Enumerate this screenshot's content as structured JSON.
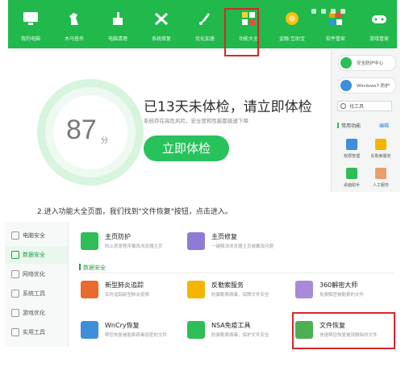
{
  "toolbar": {
    "items": [
      {
        "label": "我的电脑",
        "icon": "monitor-icon"
      },
      {
        "label": "木马查杀",
        "icon": "horse-icon"
      },
      {
        "label": "电脑清理",
        "icon": "broom-icon"
      },
      {
        "label": "系统修复",
        "icon": "wrench-icon"
      },
      {
        "label": "优化加速",
        "icon": "rocket-icon"
      },
      {
        "label": "功能大全",
        "icon": "apps-grid-icon"
      },
      {
        "label": "金融·互助宝",
        "icon": "coin-icon"
      },
      {
        "label": "软件管家",
        "icon": "software-icon"
      },
      {
        "label": "游戏管家",
        "icon": "gamepad-icon"
      }
    ],
    "highlighted_index": 5
  },
  "checkup": {
    "score": "87",
    "unit": "分",
    "headline": "已13天未体检，请立即体检",
    "subline": "系统存在高危风险，安全度和性能都极速下降",
    "button": "立即体检"
  },
  "sidebar": {
    "pills": [
      {
        "text": "安全防护中心",
        "color": "#2ebd56"
      },
      {
        "text": "Windows7·防护",
        "color": "#3d8fd9"
      }
    ],
    "search_value": "找工具",
    "common_title": "常用功能",
    "edit_label": "编辑",
    "tools": [
      {
        "label": "权限管理",
        "color": "#3d8fd9"
      },
      {
        "label": "反勒索服务",
        "color": "#f4b400"
      },
      {
        "label": "桌面助手",
        "color": "#2ebd56"
      },
      {
        "label": "人工服务",
        "color": "#e8a070"
      }
    ]
  },
  "instruction": "2.进入功能大全页面，我们找到\"文件恢复\"按钮，点击进入。",
  "nav": {
    "items": [
      {
        "label": "电脑安全",
        "active": false
      },
      {
        "label": "数据安全",
        "active": true
      },
      {
        "label": "网络优化",
        "active": false
      },
      {
        "label": "系统工具",
        "active": false
      },
      {
        "label": "游戏优化",
        "active": false
      },
      {
        "label": "实用工具",
        "active": false
      }
    ]
  },
  "features": {
    "top": [
      {
        "name": "主页防护",
        "desc": "防止恶意程序篡改浏览器主页",
        "color": "#2ebd56"
      },
      {
        "name": "主页修复",
        "desc": "一键解决浏览器主页被篡改问题",
        "color": "#8e7bd6"
      }
    ],
    "section_title": "数据安全",
    "items": [
      {
        "name": "新型肺炎追踪",
        "desc": "实时追踪新型肺炎疫情",
        "color": "#e86a2c"
      },
      {
        "name": "反勒索服务",
        "desc": "防御勒索病毒，保障文件安全",
        "color": "#f4b400"
      },
      {
        "name": "360解密大师",
        "desc": "免费解密被勒索的文件",
        "color": "#a78bd8"
      },
      {
        "name": "WnCry恢复",
        "desc": "帮您恢复被勒索病毒加密的文件",
        "color": "#3d8fd9"
      },
      {
        "name": "NSA免疫工具",
        "desc": "防御勒索病毒，保护文件安全",
        "color": "#2ebd56"
      },
      {
        "name": "文件恢复",
        "desc": "快速帮您恢复被误删除的文件",
        "color": "#4caf50"
      }
    ]
  }
}
